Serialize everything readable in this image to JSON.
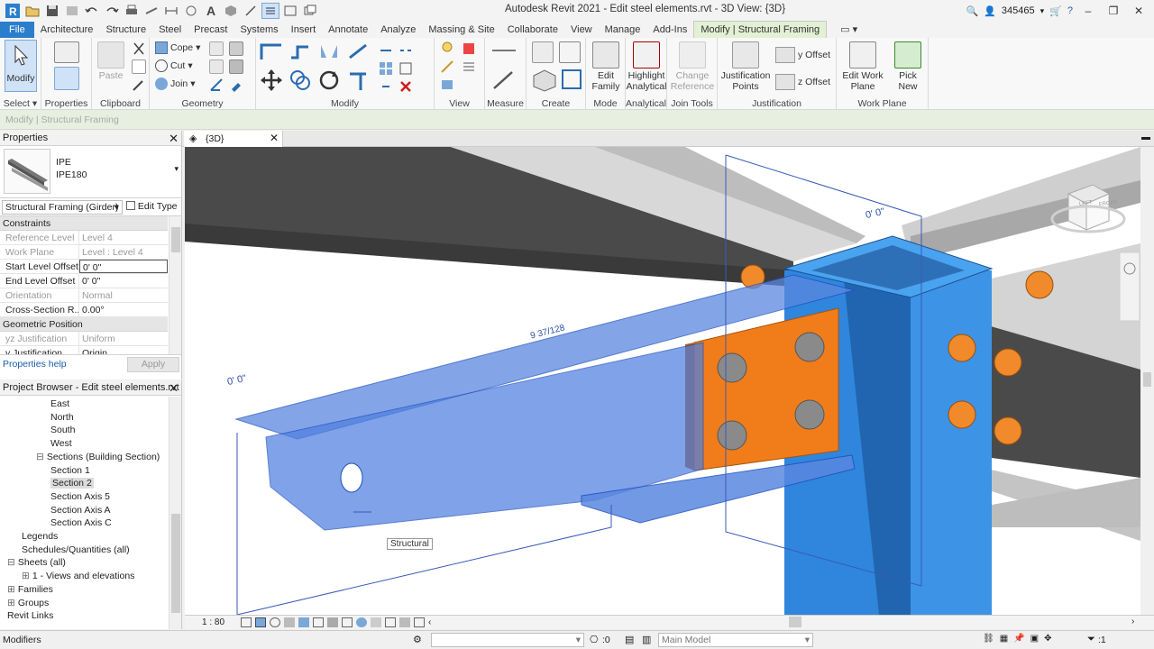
{
  "window": {
    "title": "Autodesk Revit 2021 - Edit steel elements.rvt - 3D View: {3D}",
    "user_id": "345465"
  },
  "menu_tabs": [
    "File",
    "Architecture",
    "Structure",
    "Steel",
    "Precast",
    "Systems",
    "Insert",
    "Annotate",
    "Analyze",
    "Massing & Site",
    "Collaborate",
    "View",
    "Manage",
    "Add-Ins",
    "Modify | Structural Framing"
  ],
  "ribbon": {
    "select": {
      "button": "Modify",
      "label": "Select"
    },
    "properties": {
      "label": "Properties"
    },
    "clipboard": {
      "paste": "Paste",
      "label": "Clipboard"
    },
    "geometry": {
      "cope": "Cope",
      "cut": "Cut",
      "join": "Join",
      "label": "Geometry"
    },
    "modify": {
      "label": "Modify"
    },
    "view": {
      "label": "View"
    },
    "measure": {
      "label": "Measure"
    },
    "create": {
      "label": "Create"
    },
    "mode": {
      "button": "Edit Family",
      "label": "Mode"
    },
    "analytical": {
      "button": "Highlight Analytical",
      "label": "Analytical"
    },
    "join_tools": {
      "button": "Change Reference",
      "label": "Join Tools"
    },
    "justification": {
      "button": "Justification Points",
      "y_offset": "y Offset",
      "z_offset": "z Offset",
      "label": "Justification"
    },
    "work_plane": {
      "edit": "Edit Work Plane",
      "pick": "Pick New",
      "label": "Work Plane"
    }
  },
  "context_text": "Modify | Structural Framing",
  "properties_panel": {
    "title": "Properties",
    "family": "IPE",
    "type": "IPE180",
    "selector": "Structural Framing (Girder)",
    "edit_type": "Edit Type",
    "sections": [
      {
        "name": "Constraints",
        "rows": [
          {
            "k": "Reference Level",
            "v": "Level 4",
            "grey": true
          },
          {
            "k": "Work Plane",
            "v": "Level : Level 4",
            "grey": true
          },
          {
            "k": "Start Level Offset",
            "v": "0'  0\"",
            "grey": false,
            "boxed": true
          },
          {
            "k": "End Level Offset",
            "v": "0'  0\"",
            "grey": false
          },
          {
            "k": "Orientation",
            "v": "Normal",
            "grey": true
          },
          {
            "k": "Cross-Section R...",
            "v": "0.00°",
            "grey": false
          }
        ]
      },
      {
        "name": "Geometric Position",
        "rows": [
          {
            "k": "yz Justification",
            "v": "Uniform",
            "grey": true
          },
          {
            "k": "y Justification",
            "v": "Origin",
            "grey": false
          }
        ]
      }
    ],
    "help": "Properties help",
    "apply": "Apply"
  },
  "project_browser": {
    "title": "Project Browser - Edit steel elements.rvt",
    "items": [
      {
        "label": "East",
        "indent": 3
      },
      {
        "label": "North",
        "indent": 3
      },
      {
        "label": "South",
        "indent": 3
      },
      {
        "label": "West",
        "indent": 3
      },
      {
        "label": "Sections (Building Section)",
        "indent": 2,
        "exp": "−"
      },
      {
        "label": "Section 1",
        "indent": 3
      },
      {
        "label": "Section 2",
        "indent": 3,
        "selected": true
      },
      {
        "label": "Section Axis 5",
        "indent": 3
      },
      {
        "label": "Section Axis A",
        "indent": 3
      },
      {
        "label": "Section Axis C",
        "indent": 3
      },
      {
        "label": "Legends",
        "indent": 1
      },
      {
        "label": "Schedules/Quantities (all)",
        "indent": 1
      },
      {
        "label": "Sheets (all)",
        "indent": 0,
        "exp": "−"
      },
      {
        "label": "1 - Views and elevations",
        "indent": 1,
        "exp": "+"
      },
      {
        "label": "Families",
        "indent": 0,
        "exp": "+"
      },
      {
        "label": "Groups",
        "indent": 0,
        "exp": "+"
      },
      {
        "label": "Revit Links",
        "indent": 0
      }
    ]
  },
  "view": {
    "tab": "{3D}",
    "annotation_top": "0' 0\"",
    "annotation_left": "0' 0\"",
    "dim_text": "9 37/128",
    "tooltip": "Structural",
    "cube_left": "LEFT",
    "cube_front": "FRONT",
    "scale": "1 : 80"
  },
  "status": {
    "left": "Modifiers",
    "zero": ":0",
    "model": "Main Model",
    "filter_count": ":1"
  },
  "colors": {
    "file_tab": "#2b7ecb",
    "selection_blue": "#3f7de0",
    "column_blue": "#2f86dc",
    "plate_orange": "#f07d1a",
    "beam_dark": "#4b4b4b"
  }
}
